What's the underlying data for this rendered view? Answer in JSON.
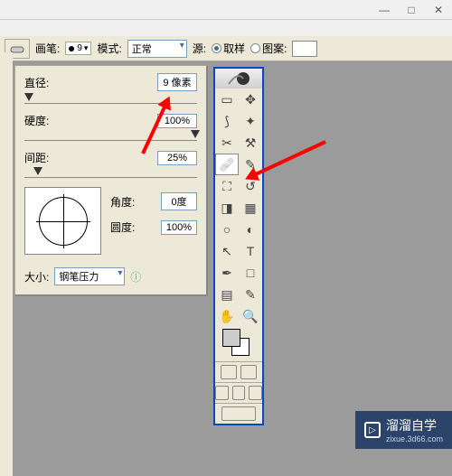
{
  "window": {
    "minimize": "—",
    "maximize": "□",
    "close": "✕"
  },
  "options": {
    "brush_label": "画笔:",
    "brush_size": "9",
    "mode_label": "模式:",
    "mode_value": "正常",
    "source_label": "源:",
    "sample_label": "取样",
    "pattern_label": "图案:"
  },
  "panel": {
    "diameter_label": "直径:",
    "diameter_value": "9 像素",
    "hardness_label": "硬度:",
    "hardness_value": "100%",
    "spacing_label": "间距:",
    "spacing_value": "25%",
    "angle_label": "角度:",
    "angle_value": "0度",
    "roundness_label": "圆度:",
    "roundness_value": "100%",
    "size_label": "大小:",
    "size_dropdown": "钢笔压力"
  },
  "tools": [
    {
      "name": "marquee-icon",
      "glyph": "▭"
    },
    {
      "name": "move-icon",
      "glyph": "✥"
    },
    {
      "name": "lasso-icon",
      "glyph": "⟆"
    },
    {
      "name": "wand-icon",
      "glyph": "✦"
    },
    {
      "name": "crop-icon",
      "glyph": "✂"
    },
    {
      "name": "slice-icon",
      "glyph": "⚒"
    },
    {
      "name": "healing-icon",
      "glyph": "🩹",
      "active": true
    },
    {
      "name": "brush-icon",
      "glyph": "✎"
    },
    {
      "name": "stamp-icon",
      "glyph": "⛶"
    },
    {
      "name": "history-icon",
      "glyph": "↺"
    },
    {
      "name": "eraser-icon",
      "glyph": "◨"
    },
    {
      "name": "gradient-icon",
      "glyph": "▦"
    },
    {
      "name": "blur-icon",
      "glyph": "○"
    },
    {
      "name": "dodge-icon",
      "glyph": "◐"
    },
    {
      "name": "path-icon",
      "glyph": "↖"
    },
    {
      "name": "type-icon",
      "glyph": "T"
    },
    {
      "name": "pen-icon",
      "glyph": "✒"
    },
    {
      "name": "shape-icon",
      "glyph": "□"
    },
    {
      "name": "notes-icon",
      "glyph": "▤"
    },
    {
      "name": "eyedrop-icon",
      "glyph": "✎"
    },
    {
      "name": "hand-icon",
      "glyph": "✋"
    },
    {
      "name": "zoom-icon",
      "glyph": "🔍"
    }
  ],
  "watermark": {
    "text": "溜溜自学",
    "sub": "zixue.3d66.com"
  }
}
